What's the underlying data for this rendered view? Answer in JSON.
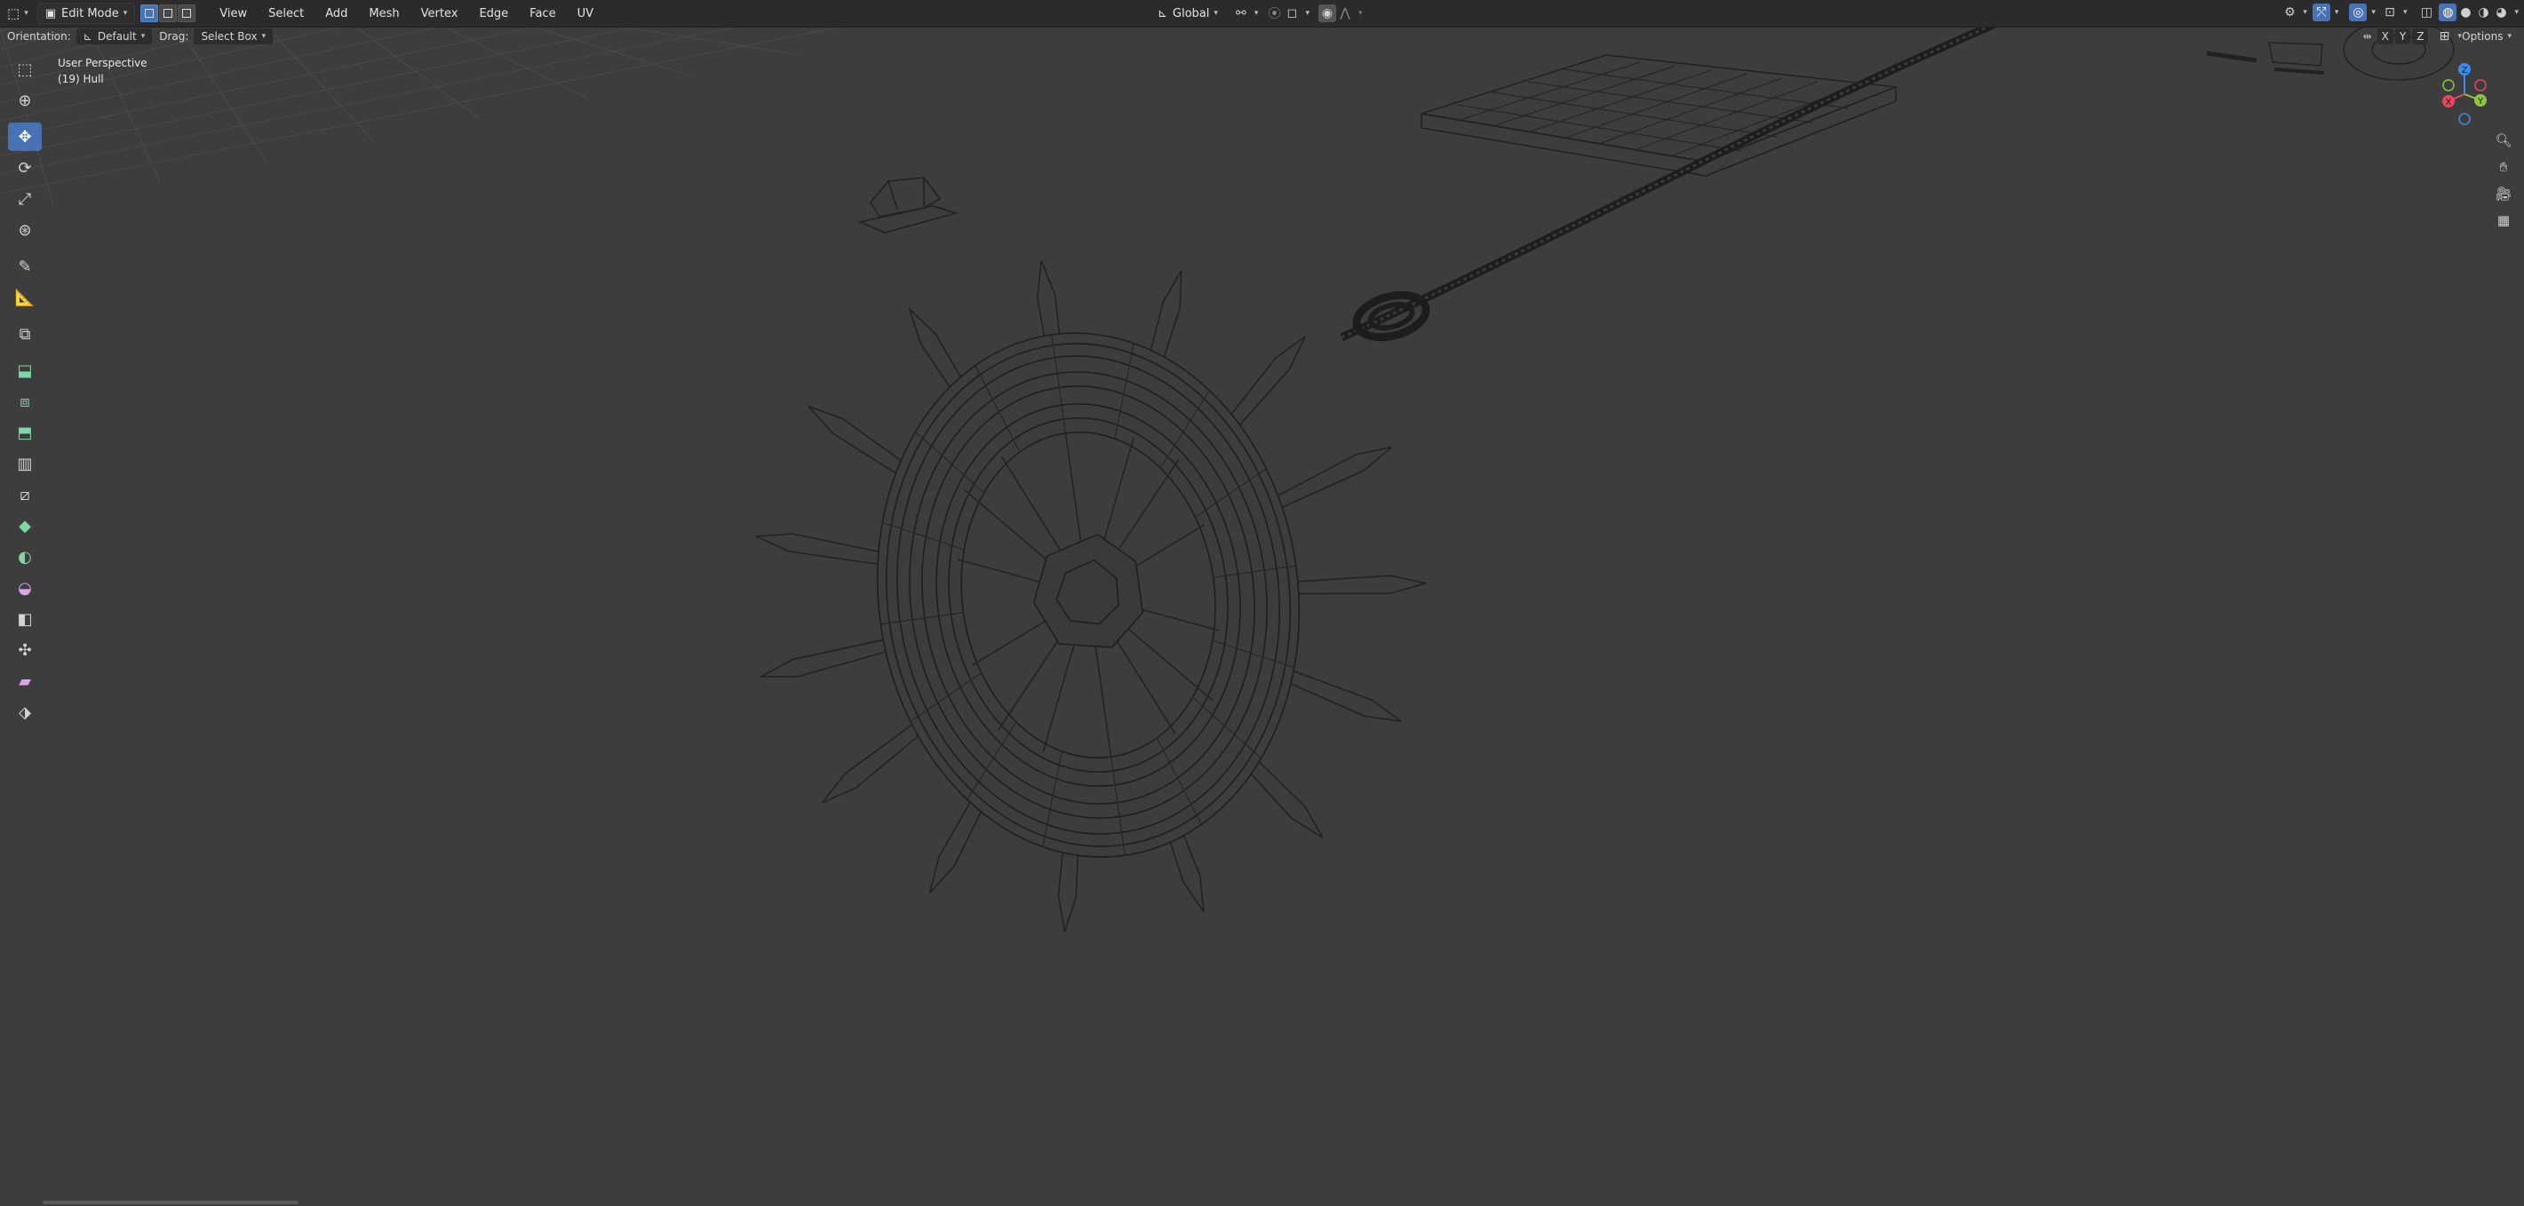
{
  "header": {
    "editor_type_icon": "3d-viewport-icon",
    "mode": "Edit Mode",
    "menu": [
      "View",
      "Select",
      "Add",
      "Mesh",
      "Vertex",
      "Edge",
      "Face",
      "UV"
    ],
    "transform_orientation": "Global",
    "options_label": "Options"
  },
  "tool_settings": {
    "orientation_label": "Orientation:",
    "orientation_value": "Default",
    "drag_label": "Drag:",
    "drag_value": "Select Box"
  },
  "viewport": {
    "view_name": "User Perspective",
    "object_info": "(19) Hull",
    "axes": {
      "x": "X",
      "y": "Y",
      "z": "Z"
    },
    "axis_colors": {
      "x": "#e8485e",
      "y": "#8cc63f",
      "z": "#3f8ce8"
    }
  },
  "accent_color": "#4772b3",
  "left_toolbar": [
    "select-box-icon",
    "cursor-icon",
    "move-icon",
    "rotate-icon",
    "scale-icon",
    "transform-icon",
    "annotate-icon",
    "measure-icon",
    "add-cube-icon",
    "extrude-icon",
    "inset-icon",
    "bevel-icon",
    "loop-cut-icon",
    "knife-icon",
    "poly-build-icon",
    "spin-icon",
    "smooth-icon",
    "edge-slide-icon",
    "shrink-fatten-icon",
    "shear-icon",
    "rip-icon"
  ]
}
